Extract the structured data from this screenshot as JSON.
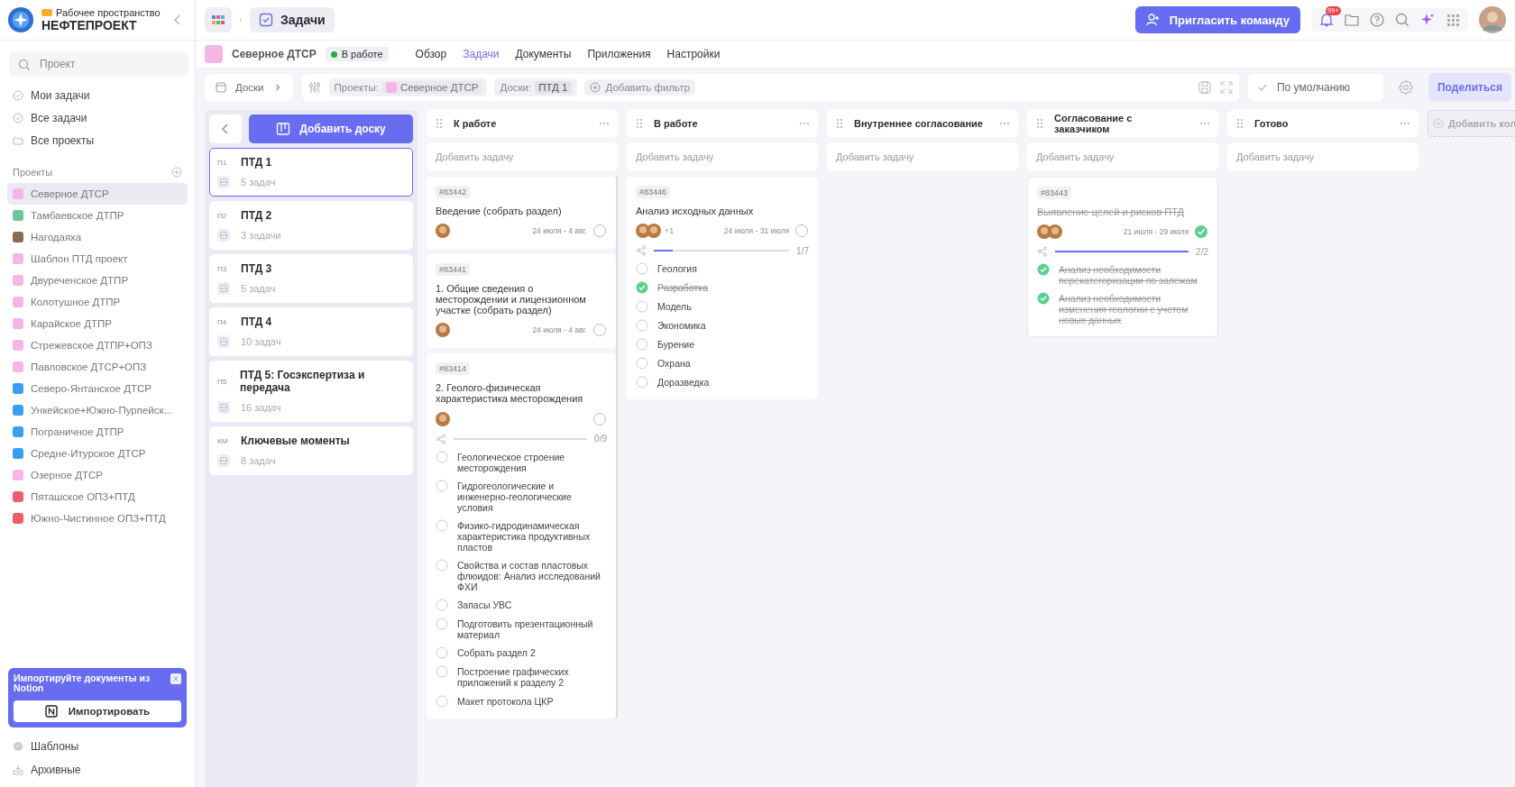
{
  "sidebar": {
    "workspace_label": "Рабочее пространство",
    "workspace_name": "НЕФТЕПРОЕКТ",
    "search": {
      "placeholder": "Проект"
    },
    "nav": [
      {
        "label": "Мои задачи",
        "kind": "check"
      },
      {
        "label": "Все задачи",
        "kind": "check"
      },
      {
        "label": "Все проекты",
        "kind": "folder"
      }
    ],
    "projects_heading": "Проекты",
    "projects": [
      {
        "name": "Северное ДТСР",
        "color": "#f4b6e4",
        "selected": true
      },
      {
        "name": "Тамбаевское ДТПР",
        "color": "#6cc79a",
        "selected": false
      },
      {
        "name": "Нагодаяха",
        "color": "#8a6a4e",
        "selected": false
      },
      {
        "name": "Шаблон ПТД проект",
        "color": "#f4b6e4",
        "selected": false
      },
      {
        "name": "Двуреченское ДТПР",
        "color": "#f4b6e4",
        "selected": false
      },
      {
        "name": "Колотушное ДТПР",
        "color": "#f4b6e4",
        "selected": false
      },
      {
        "name": "Карайское ДТПР",
        "color": "#f4b6e4",
        "selected": false
      },
      {
        "name": "Стрежевское ДТПР+ОПЗ",
        "color": "#f4b6e4",
        "selected": false
      },
      {
        "name": "Павловское ДТСР+ОПЗ",
        "color": "#f4b6e4",
        "selected": false
      },
      {
        "name": "Северо-Янтанское ДТСР",
        "color": "#3a9ef0",
        "selected": false
      },
      {
        "name": "Ункейское+Южно-Пурпейск...",
        "color": "#3a9ef0",
        "selected": false
      },
      {
        "name": "Пограничное ДТПР",
        "color": "#3a9ef0",
        "selected": false
      },
      {
        "name": "Средне-Итурское ДТСР",
        "color": "#3a9ef0",
        "selected": false
      },
      {
        "name": "Озерное ДТСР",
        "color": "#f4b6e4",
        "selected": false
      },
      {
        "name": "Пяташское ОПЗ+ПТД",
        "color": "#ef5b6e",
        "selected": false
      },
      {
        "name": "Южно-Чистинное ОПЗ+ПТД",
        "color": "#ef5b6e",
        "selected": false
      }
    ],
    "import_banner": {
      "text": "Импортируйте документы из Notion",
      "button": "Импортировать"
    },
    "footer": [
      {
        "label": "Шаблоны",
        "kind": "template"
      },
      {
        "label": "Архивные",
        "kind": "archive"
      }
    ]
  },
  "topbar": {
    "breadcrumb": "Задачи",
    "invite_button": "Пригласить команду",
    "notifications_badge": "99+"
  },
  "project_header": {
    "name": "Северное ДТСР",
    "color": "#f4b6e4",
    "status": "В работе",
    "tabs": [
      {
        "label": "Обзор",
        "selected": false
      },
      {
        "label": "Задачи",
        "selected": true
      },
      {
        "label": "Документы",
        "selected": false
      },
      {
        "label": "Приложения",
        "selected": false
      },
      {
        "label": "Настройки",
        "selected": false
      }
    ]
  },
  "toolbar": {
    "boards_button": "Доски",
    "filters": [
      {
        "label": "Проекты:",
        "value": "Северное ДТСР",
        "kind": "project",
        "color": "#f4b6e4"
      },
      {
        "label": "Доски:",
        "value": "ПТД 1",
        "kind": "plain"
      }
    ],
    "add_filter": "Добавить фильтр",
    "view": "По умолчанию",
    "share": "Поделиться"
  },
  "boards": {
    "add_button": "Добавить доску",
    "items": [
      {
        "code": "П1",
        "name": "ПТД 1",
        "count": "5 задач",
        "selected": true
      },
      {
        "code": "П2",
        "name": "ПТД 2",
        "count": "3 задачи",
        "selected": false
      },
      {
        "code": "П3",
        "name": "ПТД 3",
        "count": "5 задач",
        "selected": false
      },
      {
        "code": "П4",
        "name": "ПТД 4",
        "count": "10 задач",
        "selected": false
      },
      {
        "code": "П5",
        "name": "ПТД 5: Госэкспертиза и передача",
        "count": "16 задач",
        "selected": false
      },
      {
        "code": "КМ",
        "name": "Ключевые моменты",
        "count": "8 задач",
        "selected": false
      }
    ]
  },
  "columns": [
    {
      "title": "К работе",
      "add_placeholder": "Добавить задачу",
      "cards": [
        {
          "id": "#83442",
          "title": "Введение (собрать раздел)",
          "dates": "24 июля - 4 авг.",
          "done": false,
          "assignees": [
            {
              "kind": "photo"
            }
          ]
        },
        {
          "id": "#83441",
          "title": "1. Общие сведения о месторождении и лицензионном участке (собрать раздел)",
          "dates": "24 июля - 4 авг.",
          "done": false,
          "assignees": [
            {
              "kind": "photo"
            }
          ]
        },
        {
          "id": "#83414",
          "title": "2. Геолого-физическая характеристика месторождения",
          "done": false,
          "assignees": [
            {
              "kind": "photo"
            }
          ],
          "progress": {
            "text": "0/9",
            "level": 0
          },
          "subtasks": [
            {
              "text": "Геологическое строение месторождения",
              "checked": false
            },
            {
              "text": "Гидрогеологические и инженерно-геологические условия",
              "checked": false
            },
            {
              "text": "Физико-гидродинамическая характеристика продуктивных пластов",
              "checked": false
            },
            {
              "text": "Свойства и состав пластовых флюидов: Анализ исследований ФХИ",
              "checked": false
            },
            {
              "text": "Запасы УВС",
              "checked": false
            },
            {
              "text": "Подготовить презентационный материал",
              "checked": false
            },
            {
              "text": "Собрать раздел 2",
              "checked": false
            },
            {
              "text": "Построение графических приложений к разделу 2",
              "checked": false
            },
            {
              "text": "Макет протокола ЦКР",
              "checked": false
            }
          ]
        }
      ]
    },
    {
      "title": "В работе",
      "add_placeholder": "Добавить задачу",
      "cards": [
        {
          "id": "#83446",
          "title": "Анализ исходных данных",
          "dates": "24 июля - 31 июля",
          "done": false,
          "assignees": [
            {
              "kind": "photo"
            },
            {
              "kind": "photo"
            }
          ],
          "more": "+1",
          "progress": {
            "text": "1/7",
            "level": 0.14
          },
          "subtasks": [
            {
              "text": "Геология",
              "checked": false
            },
            {
              "text": "Разработка",
              "checked": true
            },
            {
              "text": "Модель",
              "checked": false
            },
            {
              "text": "Экономика",
              "checked": false
            },
            {
              "text": "Бурение",
              "checked": false
            },
            {
              "text": "Охрана",
              "checked": false
            },
            {
              "text": "Доразведка",
              "checked": false
            }
          ]
        }
      ]
    },
    {
      "title": "Внутреннее согласование",
      "add_placeholder": "Добавить задачу"
    },
    {
      "title": "Согласование с заказчиком",
      "add_placeholder": "Добавить задачу",
      "cards": [
        {
          "id": "#83443",
          "title": "Выявление целей и рисков ПТД",
          "dates": "21 июля - 29 июля",
          "done": true,
          "assignees": [
            {
              "kind": "photo"
            },
            {
              "kind": "photo"
            }
          ],
          "progress": {
            "text": "2/2",
            "level": 1
          },
          "subtasks": [
            {
              "text": "Анализ необходимости перекатегоризации по залежам",
              "checked": true
            },
            {
              "text": "Анализ необходимости изменения геологии с учетом новых данных",
              "checked": true
            }
          ]
        }
      ]
    },
    {
      "title": "Готово",
      "add_placeholder": "Добавить задачу"
    }
  ],
  "add_column": "Добавить кол"
}
